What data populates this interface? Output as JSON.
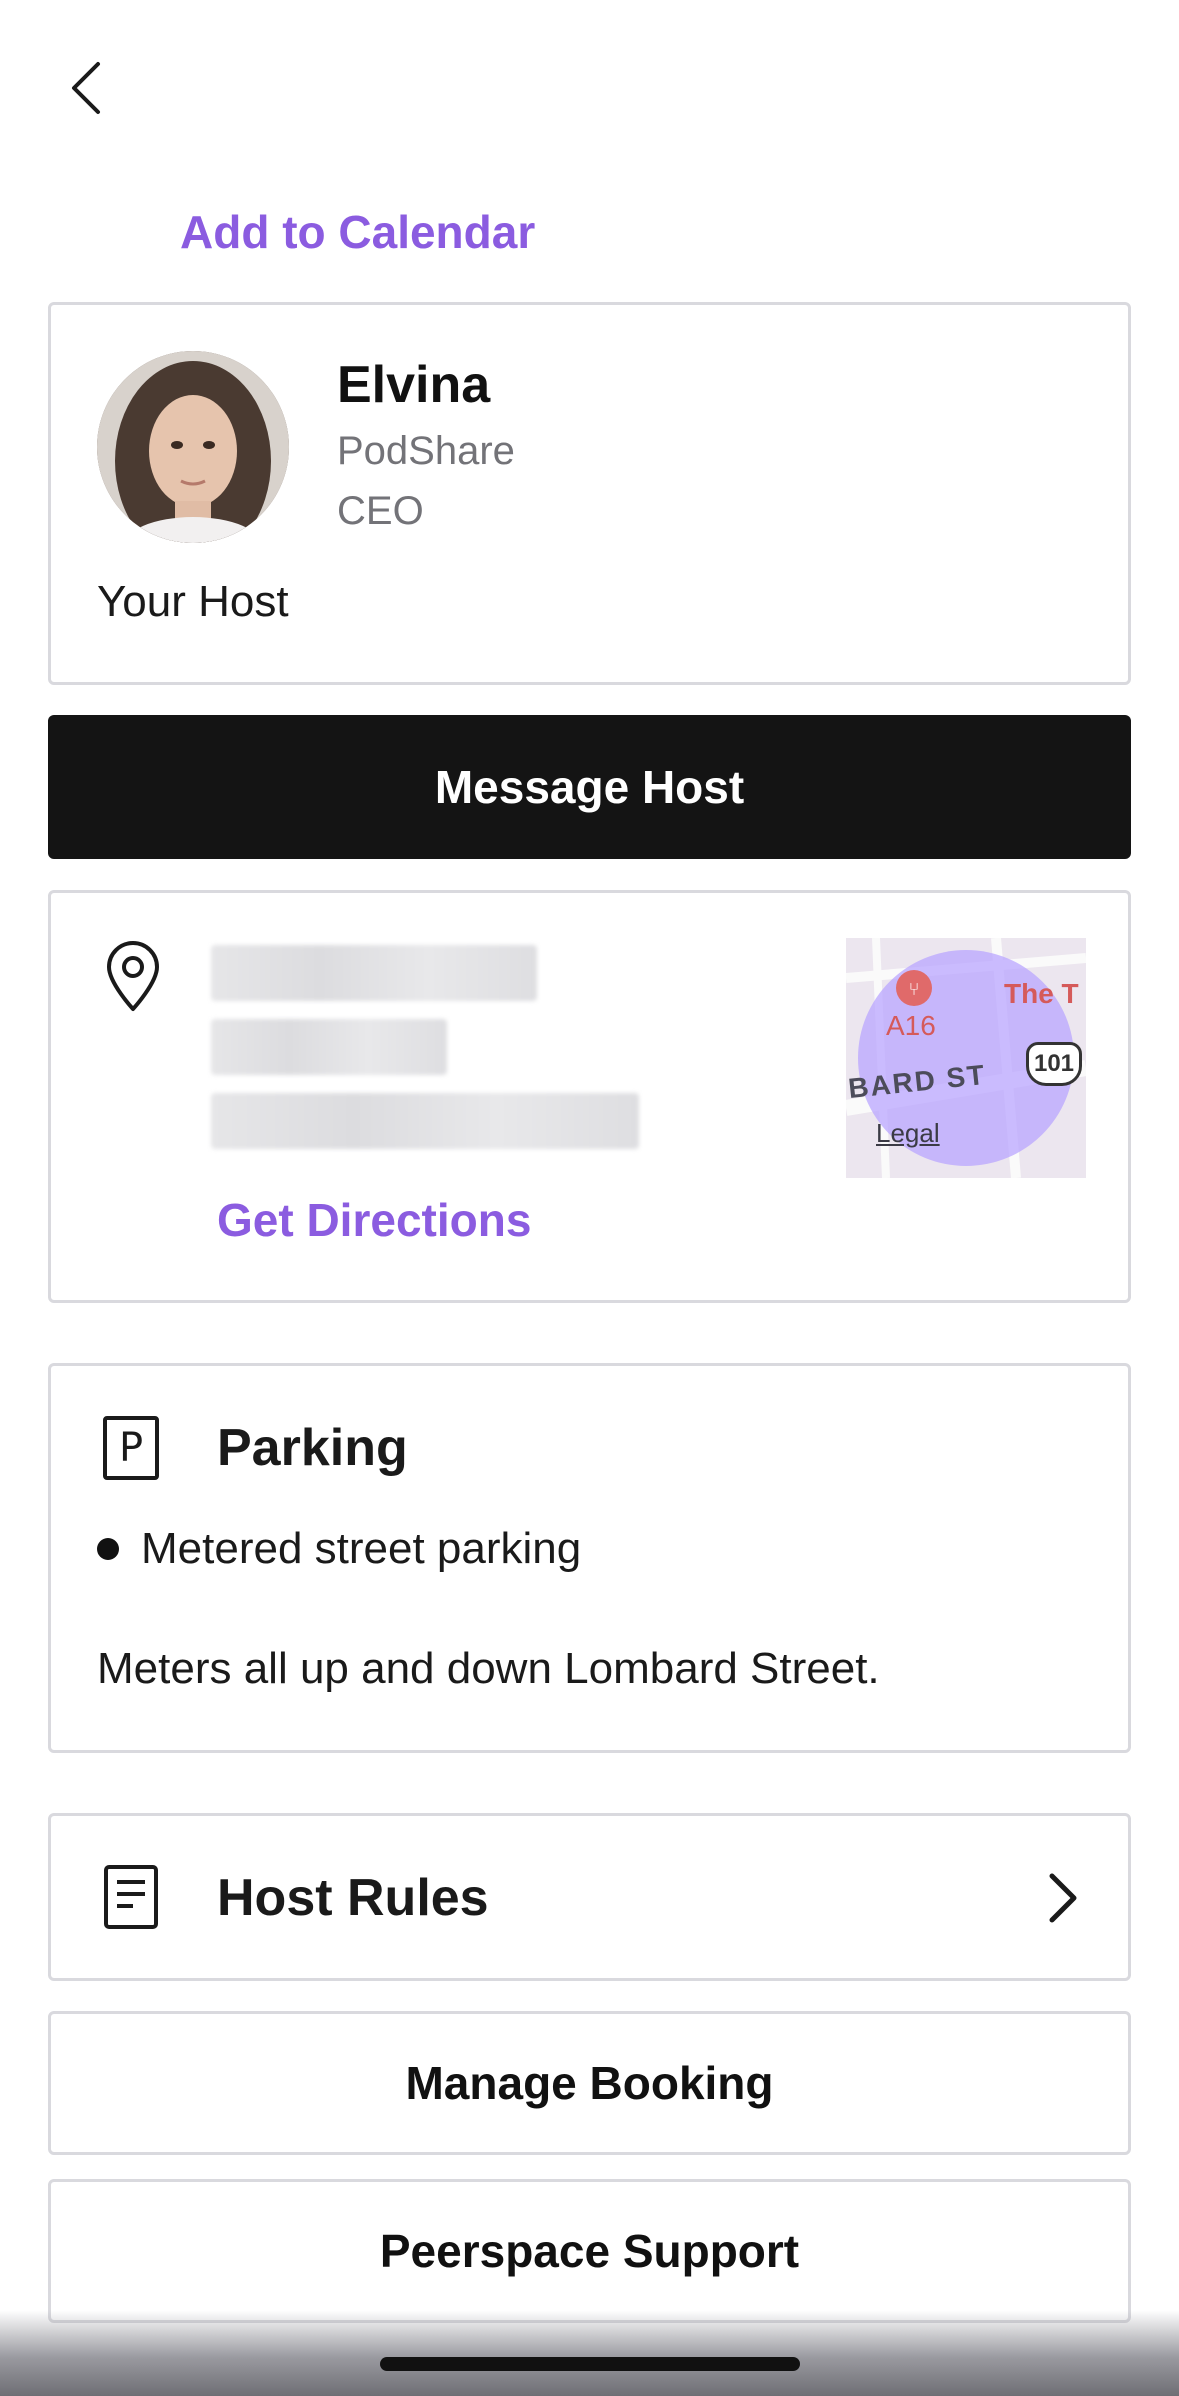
{
  "header": {
    "back_icon": "chevron-left-icon",
    "add_to_calendar": "Add to Calendar"
  },
  "host": {
    "name": "Elvina",
    "company": "PodShare",
    "title": "CEO",
    "label": "Your Host"
  },
  "actions": {
    "message_host": "Message Host",
    "manage_booking": "Manage Booking",
    "support": "Peerspace Support"
  },
  "location": {
    "icon": "map-pin-icon",
    "get_directions": "Get Directions",
    "map": {
      "restaurant_label": "A16",
      "place_label": "The T",
      "street_label": "BARD ST",
      "highway_shield": "101",
      "legal": "Legal"
    }
  },
  "parking": {
    "icon": "parking-icon",
    "title": "Parking",
    "bullet": "Metered street parking",
    "note": "Meters all up and down Lombard Street."
  },
  "rules": {
    "icon": "document-icon",
    "title": "Host Rules",
    "chevron": "chevron-right-icon"
  },
  "colors": {
    "accent": "#8b5ce0",
    "primary_button": "#141414",
    "border": "#d9d9de",
    "muted_text": "#737378"
  }
}
